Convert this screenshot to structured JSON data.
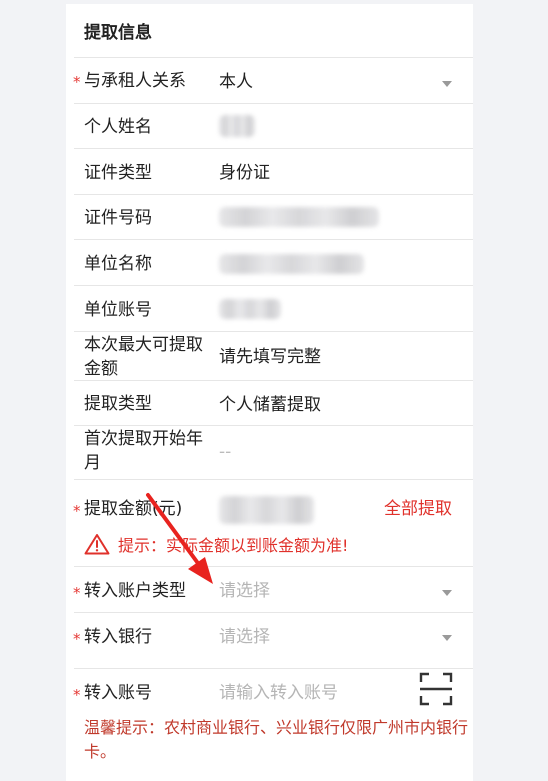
{
  "section": {
    "title": "提取信息"
  },
  "required_mark": "*",
  "fields": {
    "relation": {
      "label": "与承租人关系",
      "value": "本人"
    },
    "name": {
      "label": "个人姓名"
    },
    "id_type": {
      "label": "证件类型",
      "value": "身份证"
    },
    "id_number": {
      "label": "证件号码"
    },
    "employer_name": {
      "label": "单位名称"
    },
    "employer_account": {
      "label": "单位账号"
    },
    "max_amount": {
      "label": "本次最大可提取金额",
      "value": "请先填写完整"
    },
    "withdraw_type": {
      "label": "提取类型",
      "value": "个人储蓄提取"
    },
    "first_month": {
      "label": "首次提取开始年月",
      "value": "--"
    },
    "amount": {
      "label": "提取金额(元)",
      "action": "全部提取"
    },
    "amount_warning": "提示：实际金额以到账金额为准!",
    "account_type": {
      "label": "转入账户类型",
      "placeholder": "请选择"
    },
    "bank": {
      "label": "转入银行",
      "placeholder": "请选择"
    },
    "account_number": {
      "label": "转入账号",
      "placeholder": "请输入转入账号"
    }
  },
  "hint": "温馨提示：农村商业银行、兴业银行仅限广州市内银行卡。",
  "colors": {
    "accent_red": "#e0312b",
    "annotation_arrow": "#e8231f",
    "background": "#f2f3f6"
  },
  "icons": {
    "dropdown": "chevron-down-icon",
    "warning": "warning-triangle-icon",
    "scan": "scan-frame-icon"
  }
}
